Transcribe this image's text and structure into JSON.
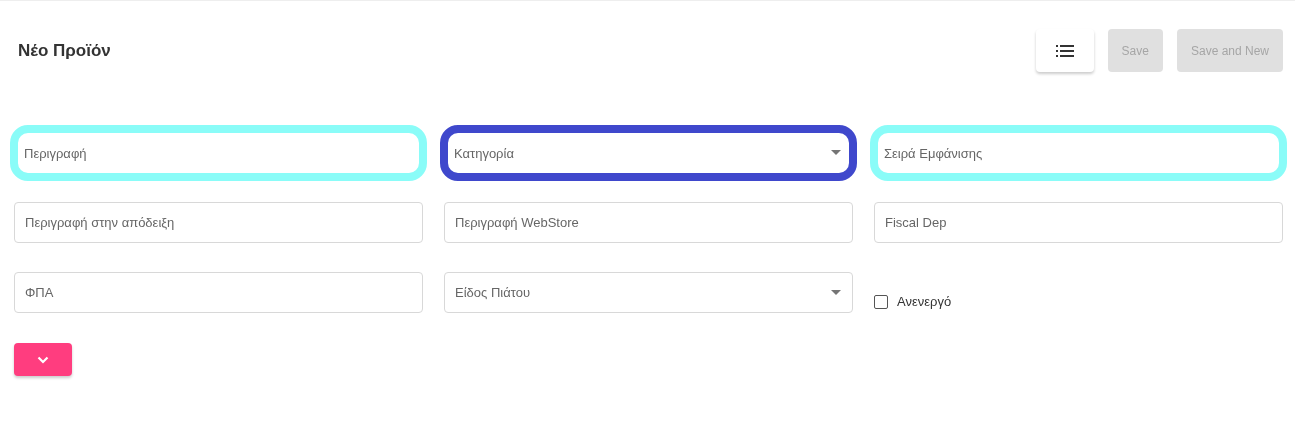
{
  "title": "Νέο Προϊόν",
  "toolbar": {
    "buttons": [
      {
        "kind": "icon",
        "disabled": false
      },
      {
        "kind": "text",
        "label": "Save",
        "disabled": true
      },
      {
        "kind": "text",
        "label": "Save and New",
        "disabled": true
      }
    ]
  },
  "fields": [
    {
      "kind": "text",
      "placeholder": "Περιγραφή",
      "color": "#8afcf8"
    },
    {
      "kind": "select",
      "placeholder": "Κατηγορία",
      "color": "#3f48cc"
    },
    {
      "kind": "text",
      "placeholder": "Σειρά Εμφάνισης",
      "color": "#8afcf8"
    },
    {
      "kind": "text",
      "placeholder": "Περιγραφή στην απόδειξη"
    },
    {
      "kind": "text",
      "placeholder": "Περιγραφή WebStore"
    },
    {
      "kind": "text",
      "placeholder": "Fiscal Dep"
    },
    {
      "kind": "text",
      "placeholder": "ΦΠΑ"
    },
    {
      "kind": "select",
      "placeholder": "Είδος Πιάτου"
    },
    {
      "kind": "checkbox",
      "label": "Ανενεργό",
      "checked": false
    }
  ],
  "expand_button": {
    "expanded": false
  }
}
